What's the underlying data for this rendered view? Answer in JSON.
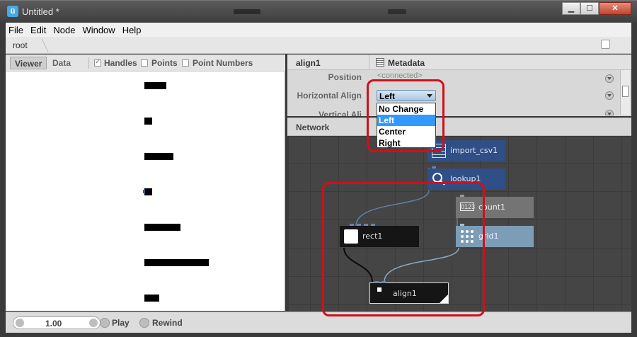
{
  "window": {
    "title": "Untitled *",
    "minimize": "▁",
    "maximize": "☐",
    "close": "✕"
  },
  "menu": [
    "File",
    "Edit",
    "Node",
    "Window",
    "Help"
  ],
  "breadcrumb": "root",
  "viewer": {
    "tabs": {
      "viewer": "Viewer",
      "data": "Data"
    },
    "options": {
      "handles": "Handles",
      "points": "Points",
      "point_numbers": "Point Numbers"
    },
    "handles_checked": true,
    "points_checked": false,
    "point_numbers_checked": false
  },
  "properties": {
    "node_name": "align1",
    "metadata_label": "Metadata",
    "rows": [
      {
        "label": "Position",
        "value": "<connected>"
      },
      {
        "label": "Horizontal Align",
        "value": "Left"
      },
      {
        "label": "Vertical Ali",
        "value": ""
      }
    ]
  },
  "dropdown": {
    "options": [
      "No Change",
      "Left",
      "Center",
      "Right"
    ],
    "selected": "Left"
  },
  "network": {
    "label": "Network",
    "nodes": [
      "import_csv1",
      "lookup1",
      "count1",
      "grid1",
      "rect1",
      "align1"
    ]
  },
  "playback": {
    "frame": "1.00",
    "play": "Play",
    "rewind": "Rewind"
  },
  "colors": {
    "accent_blue": "#3399ff",
    "annotation_red": "#d0101a",
    "node_blue": "#2f4f86",
    "node_gray": "#747474",
    "node_lightblue": "#7b9db5"
  }
}
